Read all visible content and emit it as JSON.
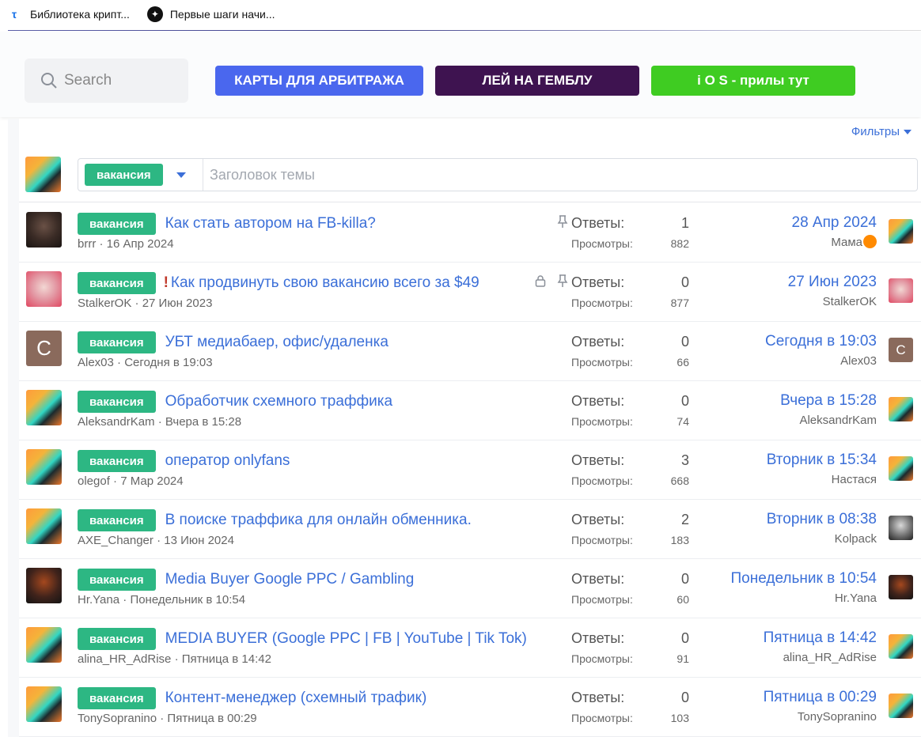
{
  "bookmarks": [
    {
      "label": "Библиотека крипт...",
      "icon": "t-icon"
    },
    {
      "label": "Первые шаги начи...",
      "icon": "star-icon"
    }
  ],
  "header": {
    "search_placeholder": "Search",
    "buttons": [
      "КАРТЫ ДЛЯ АРБИТРАЖА",
      "ЛЕЙ НА ГЕМБЛУ",
      "i O S - прилы тут"
    ]
  },
  "forum": {
    "filters_label": "Фильтры",
    "new_thread": {
      "prefix": "вакансия",
      "title_placeholder": "Заголовок темы"
    },
    "labels": {
      "replies": "Ответы:",
      "views": "Просмотры:"
    },
    "threads": [
      {
        "prefix": "вакансия",
        "title": "Как стать автором на FB-killa?",
        "author": "brrr",
        "started": "16 Апр 2024",
        "replies": "1",
        "views": "882",
        "last_date": "28 Апр 2024",
        "last_user": "Мама",
        "pinned": true,
        "locked": false,
        "important": false
      },
      {
        "prefix": "вакансия",
        "title": "Как продвинуть свою вакансию всего за $49",
        "author": "StalkerOK",
        "started": "27 Июн 2023",
        "replies": "0",
        "views": "877",
        "last_date": "27 Июн 2023",
        "last_user": "StalkerOK",
        "pinned": true,
        "locked": true,
        "important": true
      },
      {
        "prefix": "вакансия",
        "title": "УБТ медиабаер, офис/удаленка",
        "author": "Alex03",
        "started": "Сегодня в 19:03",
        "replies": "0",
        "views": "66",
        "last_date": "Сегодня в 19:03",
        "last_user": "Alex03",
        "avatar_letter": "C"
      },
      {
        "prefix": "вакансия",
        "title": "Обработчик схемного траффика",
        "author": "AleksandrKam",
        "started": "Вчера в 15:28",
        "replies": "0",
        "views": "74",
        "last_date": "Вчера в 15:28",
        "last_user": "AleksandrKam"
      },
      {
        "prefix": "вакансия",
        "title": "оператор onlyfans",
        "author": "olegof",
        "started": "7 Мар 2024",
        "replies": "3",
        "views": "668",
        "last_date": "Вторник в 15:34",
        "last_user": "Настася"
      },
      {
        "prefix": "вакансия",
        "title": "В поиске траффика для онлайн обменника.",
        "author": "AXE_Changer",
        "started": "13 Июн 2024",
        "replies": "2",
        "views": "183",
        "last_date": "Вторник в 08:38",
        "last_user": "Kolpack"
      },
      {
        "prefix": "вакансия",
        "title": "Media Buyer Google PPC / Gambling",
        "author": "Hr.Yana",
        "started": "Понедельник в 10:54",
        "replies": "0",
        "views": "60",
        "last_date": "Понедельник в 10:54",
        "last_user": "Hr.Yana"
      },
      {
        "prefix": "вакансия",
        "title": "MEDIA BUYER (Google PPC | FB | YouTube | Tik Tok)",
        "author": "alina_HR_AdRise",
        "started": "Пятница в 14:42",
        "replies": "0",
        "views": "91",
        "last_date": "Пятница в 14:42",
        "last_user": "alina_HR_AdRise"
      },
      {
        "prefix": "вакансия",
        "title": "Контент-менеджер (схемный трафик)",
        "author": "TonySopranino",
        "started": "Пятница в 00:29",
        "replies": "0",
        "views": "103",
        "last_date": "Пятница в 00:29",
        "last_user": "TonySopranino"
      }
    ]
  }
}
